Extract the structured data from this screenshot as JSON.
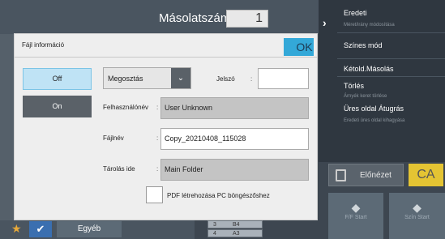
{
  "header": {
    "copies_label": "Másolatszám",
    "copies_value": "1"
  },
  "right_panel": {
    "items": [
      {
        "label": "Eredeti",
        "sub": "Méret/irány módosítása"
      },
      {
        "label": "Színes mód",
        "sub": ""
      },
      {
        "label": "Kétold.Másolás",
        "sub": ""
      },
      {
        "label": "Törlés",
        "sub": "Árnyék keret törlése"
      },
      {
        "label": "Üres oldal Átugrás",
        "sub": "Eredeti üres oldal kihagyása"
      }
    ]
  },
  "preview_label": "Előnézet",
  "ca_label": "CA",
  "start_buttons": [
    {
      "symbol": "◆",
      "label": "F/F Start"
    },
    {
      "symbol": "◆",
      "label": "Szín Start"
    }
  ],
  "bottom": {
    "other_label": "Egyéb",
    "paper": [
      {
        "num": "3",
        "size": "B4"
      },
      {
        "num": "4",
        "size": "A3"
      }
    ]
  },
  "dialog": {
    "title": "Fájl információ",
    "ok_label": "OK",
    "off_label": "Off",
    "on_label": "On",
    "mode_select": "Megosztás",
    "password_label": "Jelszó",
    "username_label": "Felhasználónév",
    "username_value": "User Unknown",
    "filename_label": "Fájlnév",
    "filename_value": "Copy_20210408_115028",
    "storage_label": "Tárolás ide",
    "storage_value": "Main Folder",
    "pdf_label": "PDF létrehozása PC böngészőshez"
  }
}
